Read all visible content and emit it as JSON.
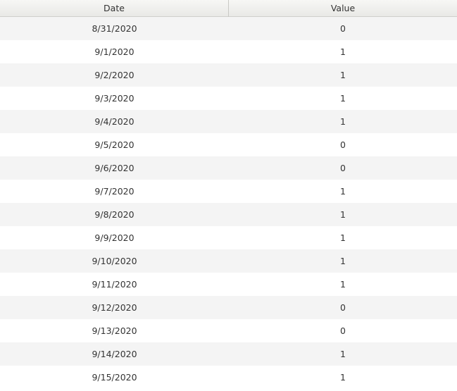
{
  "table": {
    "columns": [
      "Date",
      "Value"
    ],
    "rows": [
      [
        "8/31/2020",
        "0"
      ],
      [
        "9/1/2020",
        "1"
      ],
      [
        "9/2/2020",
        "1"
      ],
      [
        "9/3/2020",
        "1"
      ],
      [
        "9/4/2020",
        "1"
      ],
      [
        "9/5/2020",
        "0"
      ],
      [
        "9/6/2020",
        "0"
      ],
      [
        "9/7/2020",
        "1"
      ],
      [
        "9/8/2020",
        "1"
      ],
      [
        "9/9/2020",
        "1"
      ],
      [
        "9/10/2020",
        "1"
      ],
      [
        "9/11/2020",
        "1"
      ],
      [
        "9/12/2020",
        "0"
      ],
      [
        "9/13/2020",
        "0"
      ],
      [
        "9/14/2020",
        "1"
      ],
      [
        "9/15/2020",
        "1"
      ]
    ]
  }
}
